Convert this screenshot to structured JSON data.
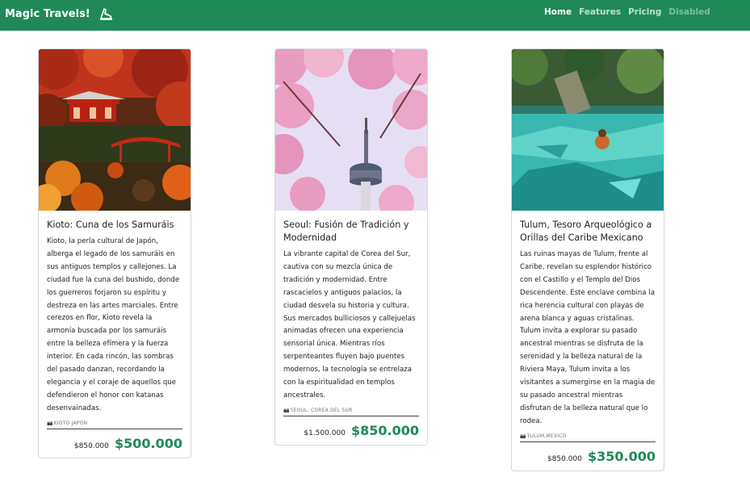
{
  "navbar": {
    "brand": "Magic Travels!",
    "brand_icon": "shoe-logo-icon",
    "links": [
      {
        "label": "Home",
        "state": "active"
      },
      {
        "label": "Features",
        "state": "normal"
      },
      {
        "label": "Pricing",
        "state": "normal"
      },
      {
        "label": "Disabled",
        "state": "disabled"
      }
    ],
    "color": "#1f8a58"
  },
  "cards": [
    {
      "title": "Kioto: Cuna de los Samuráis",
      "text": "Kioto, la perla cultural de Japón, alberga el legado de los samuráis en sus antiguos templos y callejones. La ciudad fue la cuna del bushido, donde los guerreros forjaron su espíritu y destreza en las artes marciales. Entre cerezos en flor, Kioto revela la armonía buscada por los samuráis entre la belleza efímera y la fuerza interior. En cada rincón, las sombras del pasado danzan, recordando la elegancia y el coraje de aquellos que defendieron el honor con katanas desenvainadas.",
      "location": "KIOTO JAPON",
      "old_price": "$850.000",
      "new_price": "$500.000",
      "image": "kyoto-temple-autumn"
    },
    {
      "title": "Seoul: Fusión de Tradición y Modernidad",
      "text": "La vibrante capital de Corea del Sur, cautiva con su mezcla única de tradición y modernidad. Entre rascacielos y antiguos palacios, la ciudad desvela su historia y cultura. Sus mercados bulliciosos y callejuelas animadas ofrecen una experiencia sensorial única. Mientras ríos serpenteantes fluyen bajo puentes modernos, la tecnología se entrelaza con la espiritualidad en templos ancestrales.",
      "location": "SEOUL, COREA DEL SUR",
      "old_price": "$1.500.000",
      "new_price": "$850.000",
      "image": "seoul-tower-cherry-blossom"
    },
    {
      "title": "Tulum, Tesoro Arqueológico a Orillas del Caribe Mexicano",
      "text": "Las ruinas mayas de Tulum, frente al Caribe, revelan su esplendor histórico con el Castillo y el Templo del Dios Descendente. Este enclave combina la rica herencia cultural con playas de arena blanca y aguas cristalinas. Tulum invita a explorar su pasado ancestral mientras se disfruta de la serenidad y la belleza natural de la Riviera Maya, Tulum invita a los visitantes a sumergirse en la magia de su pasado ancestral mientras disfrutan de la belleza natural que lo rodea.",
      "location": "TULUM,MEXICO",
      "old_price": "$850.000",
      "new_price": "$350.000",
      "image": "tulum-cenote"
    }
  ],
  "icons": {
    "location": "camera-icon"
  }
}
